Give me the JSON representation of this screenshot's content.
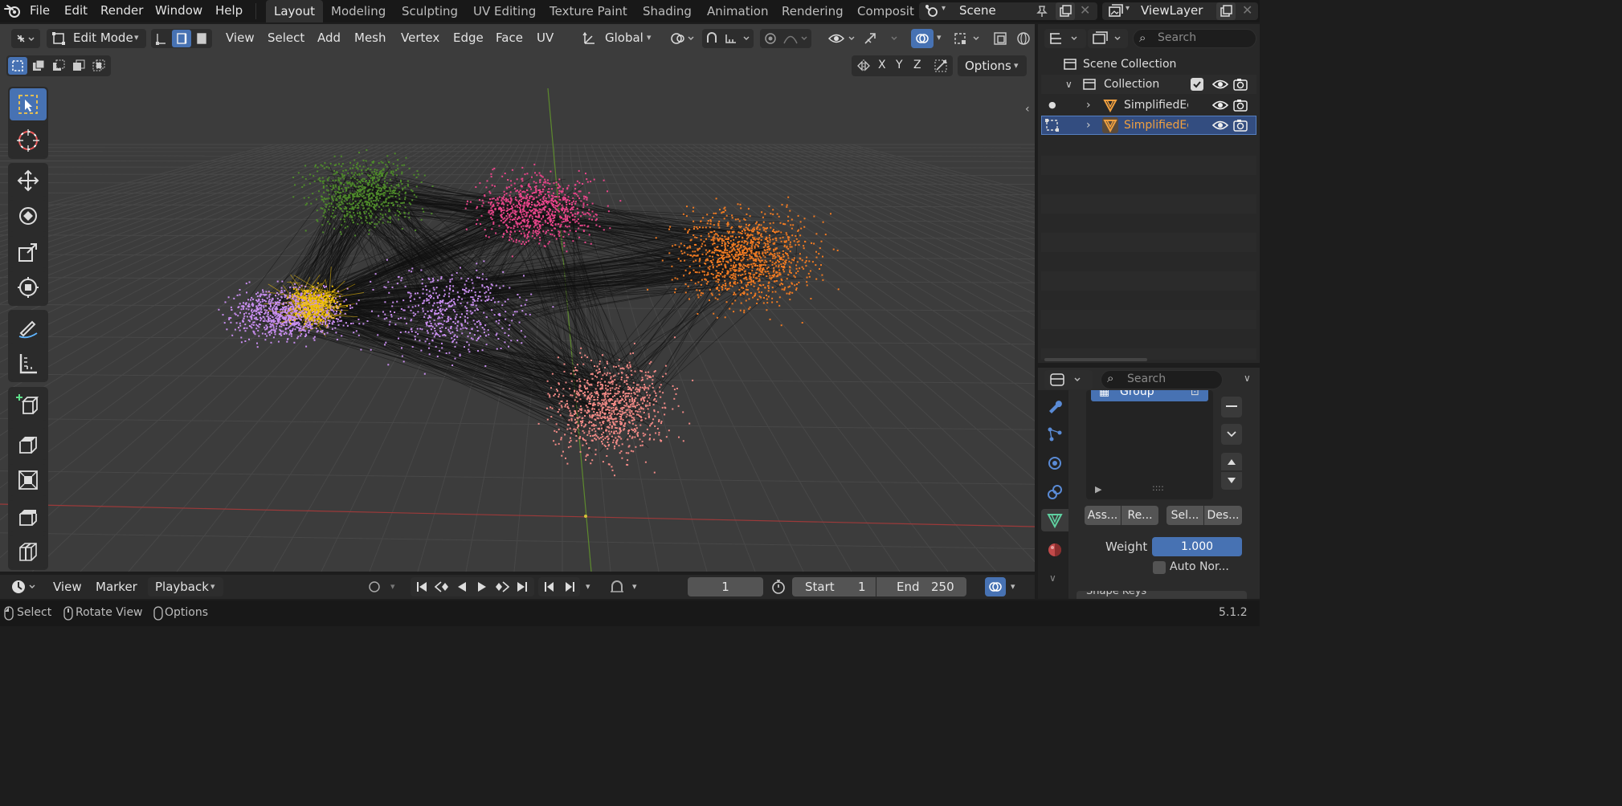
{
  "menubar": {
    "items": [
      "File",
      "Edit",
      "Render",
      "Window",
      "Help"
    ],
    "workspaces": [
      "Layout",
      "Modeling",
      "Sculpting",
      "UV Editing",
      "Texture Paint",
      "Shading",
      "Animation",
      "Rendering",
      "Composit"
    ],
    "active_workspace": "Layout",
    "scene": "Scene",
    "view_layer": "ViewLayer"
  },
  "viewport_header": {
    "mode": "Edit Mode",
    "menus": [
      "View",
      "Select",
      "Add",
      "Mesh",
      "Vertex",
      "Edge",
      "Face",
      "UV"
    ],
    "transform_orientation": "Global",
    "options_label": "Options",
    "axes": [
      "X",
      "Y",
      "Z"
    ]
  },
  "tools": [
    "select-box",
    "cursor",
    "move",
    "rotate",
    "scale",
    "transform",
    "annotate",
    "measure",
    "add-cube",
    "extrude",
    "inset",
    "bevel",
    "loop-cut"
  ],
  "outliner": {
    "search_placeholder": "Search",
    "scene_collection": "Scene Collection",
    "collection": "Collection",
    "objects": [
      "SimplifiedEc",
      "SimplifiedEc"
    ],
    "selected_index": 1
  },
  "properties": {
    "search_placeholder": "Search",
    "vertex_group": "Group",
    "buttons": [
      "Ass...",
      "Re...",
      "Sel...",
      "Des..."
    ],
    "weight_label": "Weight",
    "weight_value": "1.000",
    "auto_normalize_label": "Auto Nor...",
    "shape_keys_label": "Shape Keys"
  },
  "timeline": {
    "menus": [
      "View",
      "Marker",
      "Playback"
    ],
    "current_frame": "1",
    "start_label": "Start",
    "start_value": "1",
    "end_label": "End",
    "end_value": "250"
  },
  "statusbar": {
    "hints": [
      "Select",
      "Rotate View",
      "Options"
    ],
    "version": "5.1.2"
  },
  "colors": {
    "accent_blue": "#4772b3",
    "selected_orange": "#f0a040",
    "cluster_green": "#4e8a2a",
    "cluster_pink": "#e8458a",
    "cluster_orange": "#f07a22",
    "cluster_violet": "#c88ef0",
    "cluster_yellow": "#f2c20a",
    "cluster_salmon": "#f28a86"
  }
}
